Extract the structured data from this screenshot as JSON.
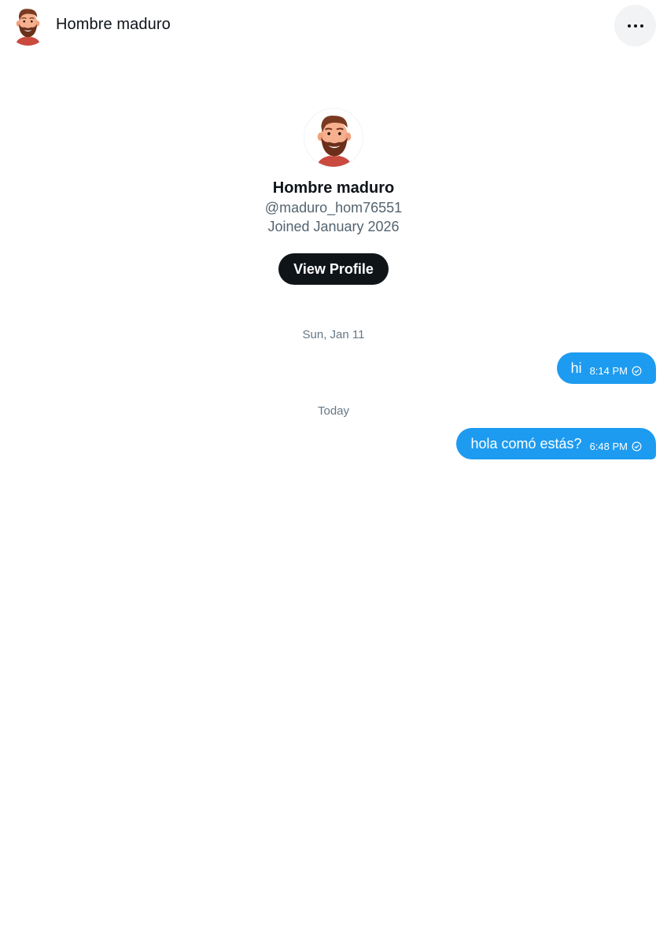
{
  "header": {
    "title": "Hombre maduro",
    "avatar_icon": "bearded-man-avatar-icon",
    "more_icon": "more-horizontal-icon"
  },
  "profile": {
    "name": "Hombre maduro",
    "handle": "@maduro_hom76551",
    "joined": "Joined January 2026",
    "view_profile_label": "View Profile"
  },
  "conversation": {
    "groups": [
      {
        "date": "Sun, Jan 11",
        "messages": [
          {
            "text": "hi",
            "time": "8:14 PM",
            "status_icon": "sent-check-icon"
          }
        ]
      },
      {
        "date": "Today",
        "messages": [
          {
            "text": "hola comó estás?",
            "time": "6:48 PM",
            "status_icon": "sent-check-icon"
          }
        ]
      }
    ]
  },
  "colors": {
    "accent": "#1d9bf0",
    "primary_text": "#0f1419",
    "secondary_text": "#536471",
    "button_bg": "#0f1419"
  }
}
